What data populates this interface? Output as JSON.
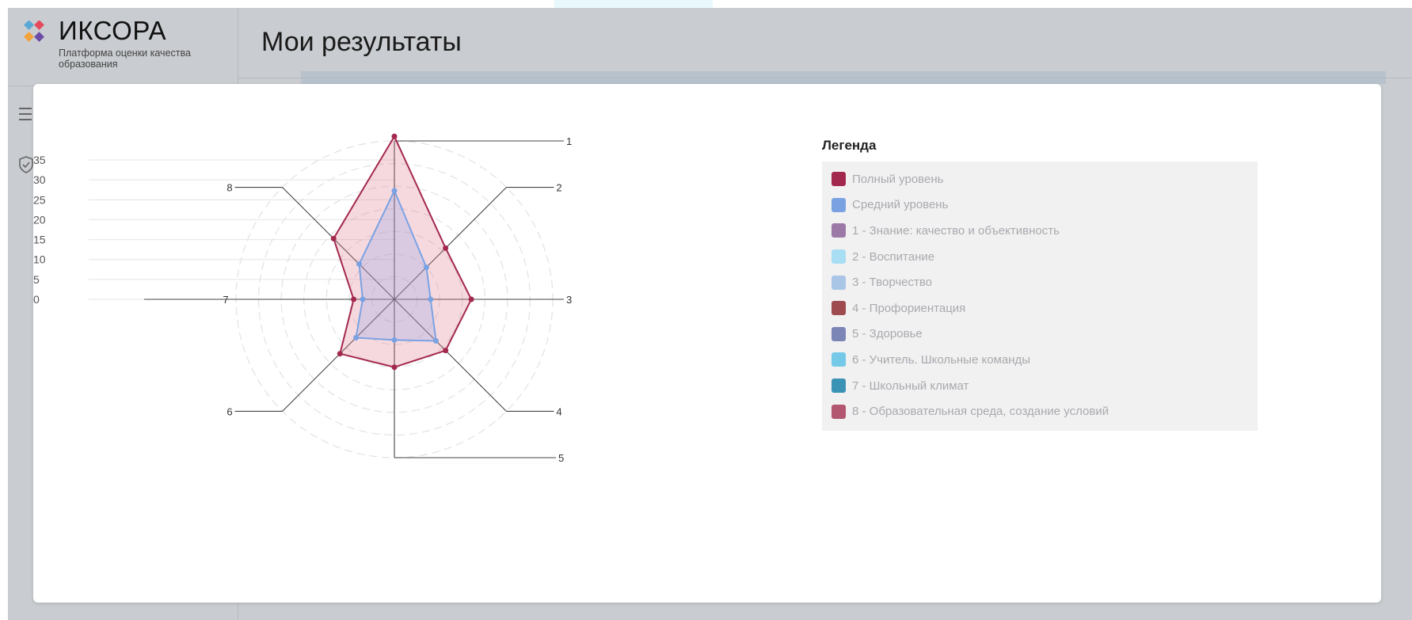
{
  "app": {
    "brand_name": "ИКСОРА",
    "brand_subtitle": "Платформа оценки качества образования",
    "page_title": "Мои результаты"
  },
  "chart_data": {
    "type": "radar",
    "categories": [
      "1",
      "2",
      "3",
      "4",
      "5",
      "6",
      "7",
      "8"
    ],
    "rlim": [
      0,
      35
    ],
    "radial_ticks": [
      0,
      5,
      10,
      15,
      20,
      25,
      30,
      35
    ],
    "grid": true,
    "legend_position": "right",
    "series": [
      {
        "name": "Полный уровень",
        "color": "#a3284e",
        "values": [
          36,
          16,
          17,
          16,
          15,
          17,
          9,
          19
        ]
      },
      {
        "name": "Средний уровень",
        "color": "#7aa2e3",
        "values": [
          24,
          10,
          8,
          13,
          9,
          12,
          7,
          11
        ]
      }
    ],
    "legend": {
      "title": "Легенда",
      "items": [
        {
          "label": "Полный уровень",
          "color": "#a3284e"
        },
        {
          "label": "Средний уровень",
          "color": "#7aa2e3"
        },
        {
          "label": "1 - Знание: качество и объективность",
          "color": "#9c78a6"
        },
        {
          "label": "2 - Воспитание",
          "color": "#a8def4"
        },
        {
          "label": "3 - Творчество",
          "color": "#a9c6e6"
        },
        {
          "label": "4 - Профориентация",
          "color": "#9e4a4e"
        },
        {
          "label": "5 - Здоровье",
          "color": "#7c86b6"
        },
        {
          "label": "6 - Учитель. Школьные команды",
          "color": "#74c8e8"
        },
        {
          "label": "7 - Школьный климат",
          "color": "#3a92b4"
        },
        {
          "label": "8 - Образовательная среда, создание условий",
          "color": "#b35670"
        }
      ]
    }
  }
}
